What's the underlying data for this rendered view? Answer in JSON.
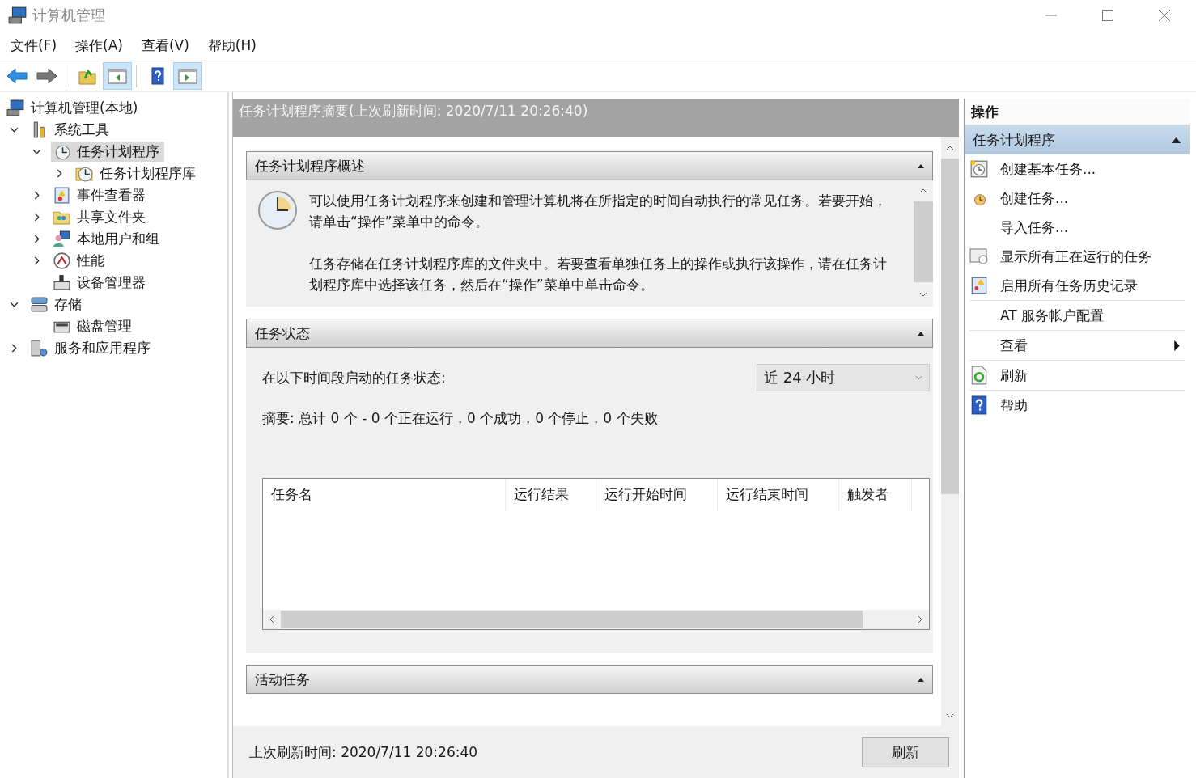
{
  "window": {
    "title": "计算机管理"
  },
  "menu": [
    "文件(F)",
    "操作(A)",
    "查看(V)",
    "帮助(H)"
  ],
  "toolbar": [
    {
      "kind": "back",
      "pressed": false
    },
    {
      "kind": "forward",
      "pressed": false
    },
    {
      "kind": "up",
      "pressed": false
    },
    {
      "kind": "tree-pane",
      "pressed": true
    },
    {
      "kind": "help",
      "pressed": false
    },
    {
      "kind": "action-pane",
      "pressed": true
    }
  ],
  "tree": [
    {
      "label": "计算机管理(本地)",
      "kind": "computer",
      "selected": false,
      "children": [
        {
          "label": "系统工具",
          "kind": "tools",
          "expanded": true,
          "selected": false,
          "children": [
            {
              "label": "任务计划程序",
              "kind": "clock",
              "expanded": true,
              "selected": true,
              "children": [
                {
                  "label": "任务计划程序库",
                  "kind": "folder-clock",
                  "expanded": false,
                  "selected": false
                }
              ]
            },
            {
              "label": "事件查看器",
              "kind": "log",
              "expanded": false,
              "selected": false
            },
            {
              "label": "共享文件夹",
              "kind": "share",
              "expanded": false,
              "selected": false
            },
            {
              "label": "本地用户和组",
              "kind": "users",
              "expanded": false,
              "selected": false
            },
            {
              "label": "性能",
              "kind": "gauge",
              "expanded": false,
              "selected": false
            },
            {
              "label": "设备管理器",
              "kind": "device",
              "selected": false
            }
          ]
        },
        {
          "label": "存储",
          "kind": "storage",
          "expanded": true,
          "selected": false,
          "children": [
            {
              "label": "磁盘管理",
              "kind": "disk",
              "selected": false
            }
          ]
        },
        {
          "label": "服务和应用程序",
          "kind": "services",
          "expanded": false,
          "selected": false
        }
      ]
    }
  ],
  "summary": {
    "title": "任务计划程序摘要(上次刷新时间: 2020/7/11 20:26:40)",
    "sections": [
      {
        "kind": "overview",
        "title": "任务计划程序概述",
        "expanded": true,
        "paragraphs": [
          "可以使用任务计划程序来创建和管理计算机将在所指定的时间自动执行的常见任务。若要开始，请单击“操作”菜单中的命令。",
          "任务存储在任务计划程序库的文件夹中。若要查看单独任务上的操作或执行该操作，请在任务计划程序库中选择该任务，然后在“操作”菜单中单击命令。"
        ]
      },
      {
        "kind": "status",
        "title": "任务状态",
        "expanded": true,
        "period_label": "在以下时间段启动的任务状态:",
        "period": "近 24 小时",
        "summary": "摘要: 总计 0 个 - 0 个正在运行，0 个成功，0 个停止，0 个失败",
        "columns": [
          "任务名",
          "运行结果",
          "运行开始时间",
          "运行结束时间",
          "触发者"
        ]
      },
      {
        "kind": "active",
        "title": "活动任务",
        "expanded": true
      }
    ],
    "footer": {
      "last_refresh": "上次刷新时间: 2020/7/11 20:26:40",
      "button": "刷新"
    }
  },
  "actions": {
    "title": "操作",
    "groups": [
      {
        "title": "任务计划程序",
        "expanded": true,
        "items": [
          {
            "label": "创建基本任务...",
            "kind": "basic-task",
            "submenu": false,
            "separator": false
          },
          {
            "label": "创建任务...",
            "kind": "task",
            "submenu": false,
            "separator": false
          },
          {
            "label": "导入任务...",
            "kind": "plain",
            "submenu": false,
            "separator": false
          },
          {
            "label": "显示所有正在运行的任务",
            "kind": "running",
            "submenu": false,
            "separator": false
          },
          {
            "label": "启用所有任务历史记录",
            "kind": "history",
            "submenu": false,
            "separator": true
          },
          {
            "label": "AT 服务帐户配置",
            "kind": "plain",
            "submenu": false,
            "separator": true
          },
          {
            "label": "查看",
            "kind": "plain",
            "submenu": true,
            "separator": true
          },
          {
            "label": "刷新",
            "kind": "refresh",
            "submenu": false,
            "separator": true
          },
          {
            "label": "帮助",
            "kind": "help",
            "submenu": false,
            "separator": false
          }
        ]
      }
    ]
  }
}
